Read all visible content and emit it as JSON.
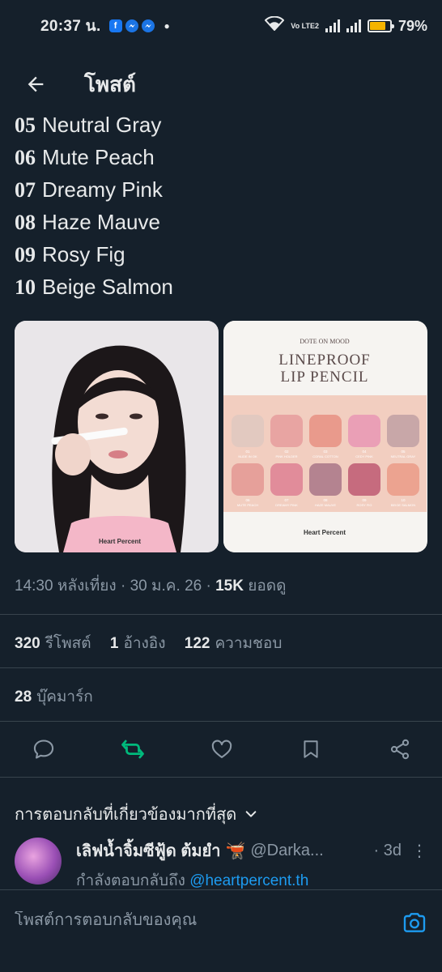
{
  "status_bar": {
    "time": "20:37 น.",
    "apps": [
      "facebook-icon",
      "messenger-icon",
      "messenger-icon"
    ],
    "network": "Vo LTE2",
    "battery": "79%",
    "battery_level": 0.79
  },
  "header": {
    "title": "โพสต์"
  },
  "shades": [
    {
      "num": "05",
      "name": "Neutral Gray"
    },
    {
      "num": "06",
      "name": "Mute Peach"
    },
    {
      "num": "07",
      "name": "Dreamy Pink"
    },
    {
      "num": "08",
      "name": "Haze Mauve"
    },
    {
      "num": "09",
      "name": "Rosy Fig"
    },
    {
      "num": "10",
      "name": "Beige Salmon"
    }
  ],
  "media": {
    "left_brand": "Heart Percent",
    "right_subtitle": "DOTE ON MOOD",
    "right_title_1": "LINEPROOF",
    "right_title_2": "LIP PENCIL",
    "right_brand": "Heart Percent",
    "swatches_top": [
      {
        "num": "01",
        "name": "NUDE IN OK",
        "color": "#e2c9c0"
      },
      {
        "num": "02",
        "name": "PINK HOLDER",
        "color": "#e8a4a2"
      },
      {
        "num": "03",
        "name": "CORAL COTTON",
        "color": "#e99a8c"
      },
      {
        "num": "04",
        "name": "CEDY PINK",
        "color": "#ea9fb6"
      },
      {
        "num": "05",
        "name": "NEUTRAL GRAY",
        "color": "#c8a7a8"
      }
    ],
    "swatches_bottom": [
      {
        "num": "06",
        "name": "MUTE PEACH",
        "color": "#e6a09a"
      },
      {
        "num": "07",
        "name": "DREAMY PINK",
        "color": "#e18c9a"
      },
      {
        "num": "08",
        "name": "HAZE MAUVE",
        "color": "#b48390"
      },
      {
        "num": "09",
        "name": "ROSY FIG",
        "color": "#c66b7e"
      },
      {
        "num": "10",
        "name": "BEIGE SALMON",
        "color": "#eca390"
      }
    ]
  },
  "meta": {
    "time": "14:30 หลังเที่ยง",
    "date": "30 ม.ค. 26",
    "views": "15K",
    "views_label": "ยอดดู"
  },
  "stats": {
    "reposts": "320",
    "reposts_label": "รีโพสต์",
    "quotes": "1",
    "quotes_label": "อ้างอิง",
    "likes": "122",
    "likes_label": "ความชอบ",
    "bookmarks": "28",
    "bookmarks_label": "บุ๊คมาร์ก"
  },
  "colors": {
    "accent": "#1d9bf0",
    "repost_green": "#00ba7c",
    "background": "#15202b"
  },
  "relevant_label": "การตอบกลับที่เกี่ยวข้องมากที่สุด",
  "reply": {
    "name": "เลิฟน้ำจิ้มซีฟู้ด ต้มยำ",
    "emoji": "🫕",
    "handle": "@Darka...",
    "time": "· 3d",
    "replying_prefix": "กำลังตอบกลับถึง",
    "replying_to": "@heartpercent.th"
  },
  "composer": {
    "placeholder": "โพสต์การตอบกลับของคุณ"
  }
}
